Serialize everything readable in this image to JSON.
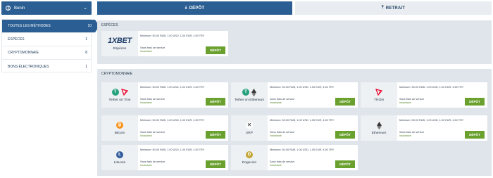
{
  "country_selector": {
    "label": "Benin",
    "icon": "globe-icon",
    "chevron": "chevron-down-icon"
  },
  "tabs": {
    "depot": {
      "label": "DÉPÔT",
      "icon": "download-icon"
    },
    "retrait": {
      "label": "RETRAIT",
      "icon": "upload-icon"
    }
  },
  "sidebar": {
    "items": [
      {
        "label": "TOUTES LES MÉTHODES",
        "count": "10",
        "active": true
      },
      {
        "label": "ESPÈCES",
        "count": "1"
      },
      {
        "label": "CRYPTOMONNAIE",
        "count": "8"
      },
      {
        "label": "BONS ÉLECTRONIQUES",
        "count": "1"
      }
    ]
  },
  "sections": {
    "especes": {
      "title": "ESPÈCES",
      "cards": [
        {
          "name": "Espèces",
          "logo_text_1": "1X",
          "logo_text_2": "BET",
          "minimum": "Minimum: 50.00 RUB, 1.00 USD, 1.00 EUR, 4.50 TRY",
          "fee": "Sans frais de service",
          "speed": "Instantané",
          "button": "DÉPÔT"
        }
      ]
    },
    "crypto": {
      "title": "CRYPTOMONNAIE",
      "cards": [
        {
          "name": "Tether on Tron",
          "icons": [
            "tether-icon",
            "tron-icon"
          ],
          "minimum": "Minimum: 50.00 RUB, 1.00 USD, 1.00 EUR, 4.50 TRY",
          "fee": "Sans frais de service",
          "speed": "Instantané",
          "button": "DÉPÔT"
        },
        {
          "name": "Tether on Ethereum",
          "icons": [
            "tether-icon",
            "ethereum-icon"
          ],
          "minimum": "Minimum: 50.00 RUB, 1.00 USD, 1.00 EUR, 4.50 TRY",
          "fee": "Sans frais de service",
          "speed": "Instantané",
          "button": "DÉPÔT"
        },
        {
          "name": "TRON",
          "icons": [
            "tron-icon"
          ],
          "minimum": "Minimum: 50.00 RUB, 1.00 USD, 1.00 EUR, 4.50 TRY",
          "fee": "Sans frais de service",
          "speed": "Instantané",
          "button": "DÉPÔT"
        },
        {
          "name": "Bitcoin",
          "icons": [
            "bitcoin-icon"
          ],
          "minimum": "Minimum: 50.00 RUB, 1.00 USD, 1.00 EUR, 4.50 TRY",
          "fee": "Sans frais de service",
          "speed": "Instantané",
          "button": "DÉPÔT"
        },
        {
          "name": "XRP",
          "icons": [
            "xrp-icon"
          ],
          "minimum": "Minimum: 50.00 RUB, 1.00 USD, 1.00 EUR, 4.50 TRY",
          "fee": "Sans frais de service",
          "speed": "Instantané",
          "button": "DÉPÔT"
        },
        {
          "name": "Ethereum",
          "icons": [
            "ethereum-icon"
          ],
          "minimum": "Minimum: 50.00 RUB, 1.00 USD, 1.00 EUR, 4.50 TRY",
          "fee": "Sans frais de service",
          "speed": "Instantané",
          "button": "DÉPÔT"
        },
        {
          "name": "Litecoin",
          "icons": [
            "litecoin-icon"
          ],
          "minimum": "Minimum: 50.00 RUB, 1.00 USD, 1.00 EUR, 4.50 TRY",
          "fee": "Sans frais de service",
          "speed": "Instantané",
          "button": "DÉPÔT"
        },
        {
          "name": "Dogecoin",
          "icons": [
            "dogecoin-icon"
          ],
          "minimum": "Minimum: 50.00 RUB, 1.00 USD, 1.00 EUR, 4.50 TRY",
          "fee": "Sans frais de service",
          "speed": "Instantané",
          "button": "DÉPÔT"
        }
      ]
    }
  },
  "colors": {
    "primary": "#2b5f93",
    "button_green": "#6aa12e",
    "section_bg": "#dfe5ea",
    "tether": "#26a17b",
    "tron": "#eb0029",
    "bitcoin": "#f7931a",
    "litecoin": "#345d9d",
    "dogecoin": "#c3a634",
    "ethereum": "#3c3c3d"
  }
}
